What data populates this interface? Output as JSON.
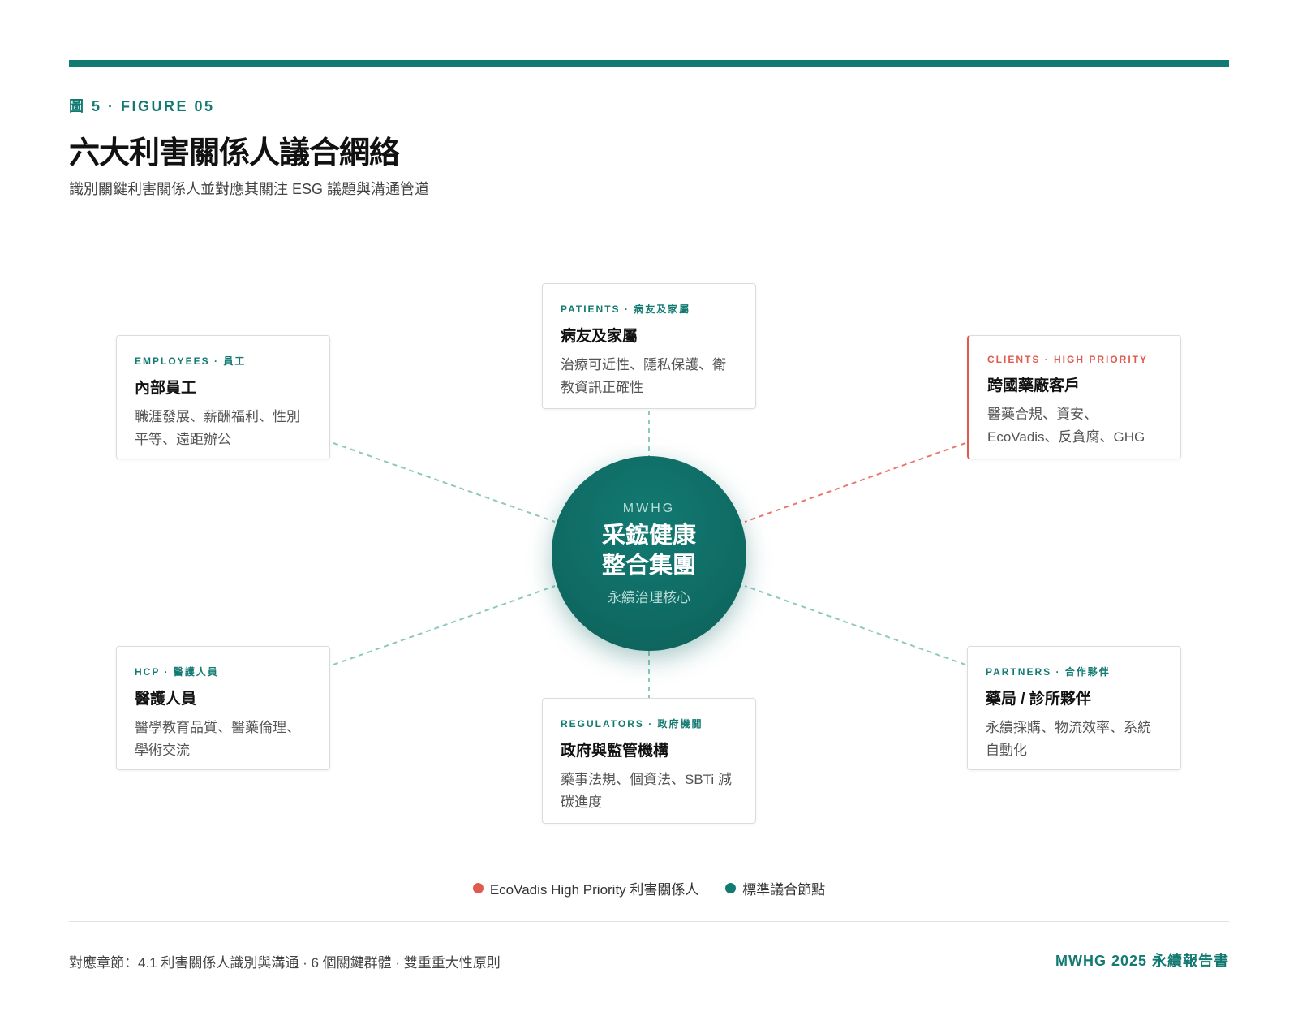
{
  "header": {
    "figure_label": "圖 5 · FIGURE 05",
    "title": "六大利害關係人議合網絡",
    "subtitle": "識別關鍵利害關係人並對應其關注 ESG 議題與溝通管道"
  },
  "hub": {
    "org": "MWHG",
    "name_line1": "采鋐健康",
    "name_line2": "整合集團",
    "subtitle": "永續治理核心"
  },
  "stakeholders": [
    {
      "tag": "PATIENTS · 病友及家屬",
      "name": "病友及家屬",
      "desc": "治療可近性、隱私保護、衛教資訊正確性",
      "priority": false
    },
    {
      "tag": "EMPLOYEES · 員工",
      "name": "內部員工",
      "desc": "職涯發展、薪酬福利、性別平等、遠距辦公",
      "priority": false
    },
    {
      "tag": "CLIENTS · HIGH PRIORITY",
      "name": "跨國藥廠客戶",
      "desc": "醫藥合規、資安、EcoVadis、反貪腐、GHG",
      "priority": true
    },
    {
      "tag": "HCP · 醫護人員",
      "name": "醫護人員",
      "desc": "醫學教育品質、醫藥倫理、學術交流",
      "priority": false
    },
    {
      "tag": "REGULATORS · 政府機關",
      "name": "政府與監管機構",
      "desc": "藥事法規、個資法、SBTi 減碳進度",
      "priority": false
    },
    {
      "tag": "PARTNERS · 合作夥伴",
      "name": "藥局 / 診所夥伴",
      "desc": "永續採購、物流效率、系統自動化",
      "priority": false
    }
  ],
  "legend": {
    "priority_label": "EcoVadis High Priority 利害關係人",
    "standard_label": "標準議合節點"
  },
  "colors": {
    "accent": "#137a72",
    "priority": "#e05a4f",
    "link": "#8cc8bf"
  },
  "footer": {
    "left": "對應章節：4.1 利害關係人識別與溝通 · 6 個關鍵群體 · 雙重重大性原則",
    "right": "MWHG 2025 永續報告書"
  }
}
